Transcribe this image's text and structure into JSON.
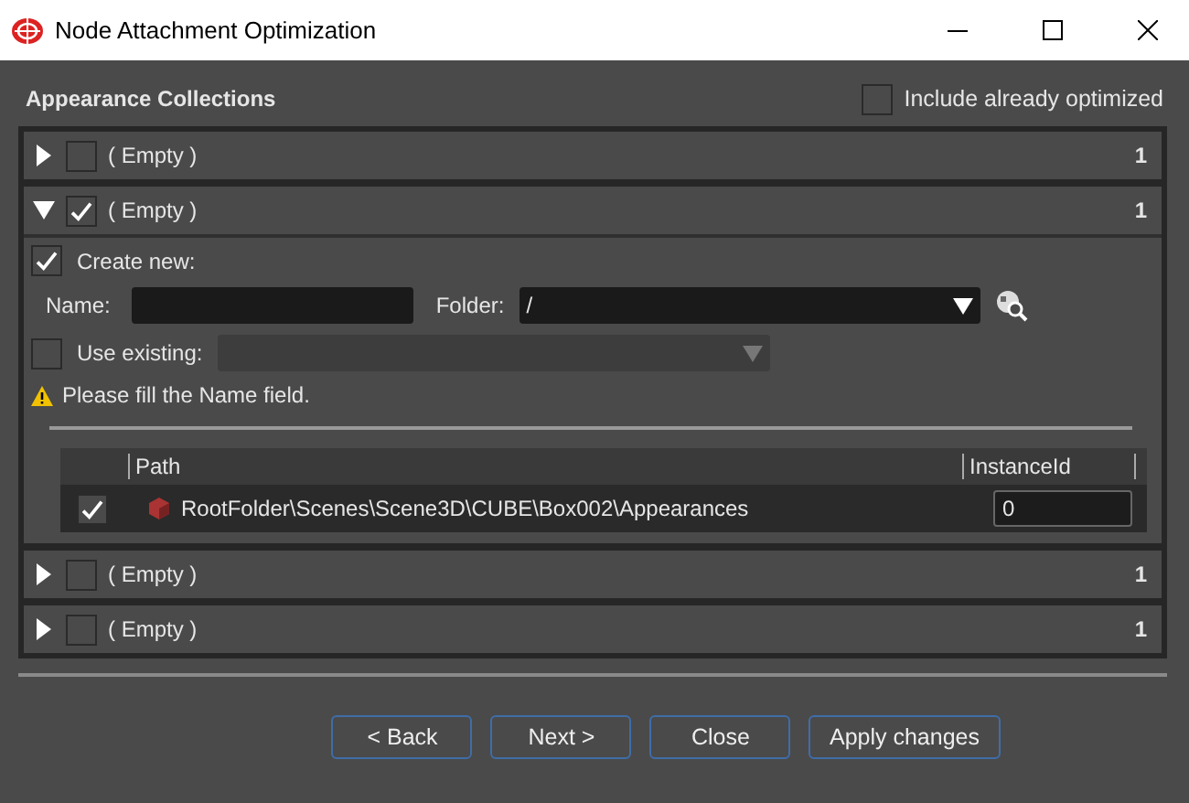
{
  "window": {
    "title": "Node Attachment Optimization"
  },
  "section_title": "Appearance Collections",
  "include_optimized": {
    "label": "Include already optimized",
    "checked": false
  },
  "collections": [
    {
      "label": "( Empty )",
      "count": "1",
      "checked": false,
      "expanded": false
    },
    {
      "label": "( Empty )",
      "count": "1",
      "checked": true,
      "expanded": true,
      "details": {
        "create_new": {
          "label": "Create new:",
          "checked": true
        },
        "name": {
          "label": "Name:"
        },
        "folder": {
          "label": "Folder:",
          "value": "/"
        },
        "use_existing": {
          "label": "Use existing:",
          "checked": false
        },
        "warning": "Please fill the Name field.",
        "table": {
          "columns": [
            "Path",
            "InstanceId"
          ],
          "rows": [
            {
              "checked": true,
              "path": "RootFolder\\Scenes\\Scene3D\\CUBE\\Box002\\Appearances",
              "instance_id": "0"
            }
          ]
        }
      }
    },
    {
      "label": "( Empty )",
      "count": "1",
      "checked": false,
      "expanded": false
    },
    {
      "label": "( Empty )",
      "count": "1",
      "checked": false,
      "expanded": false
    }
  ],
  "buttons": [
    "< Back",
    "Next >",
    "Close",
    "Apply changes"
  ]
}
